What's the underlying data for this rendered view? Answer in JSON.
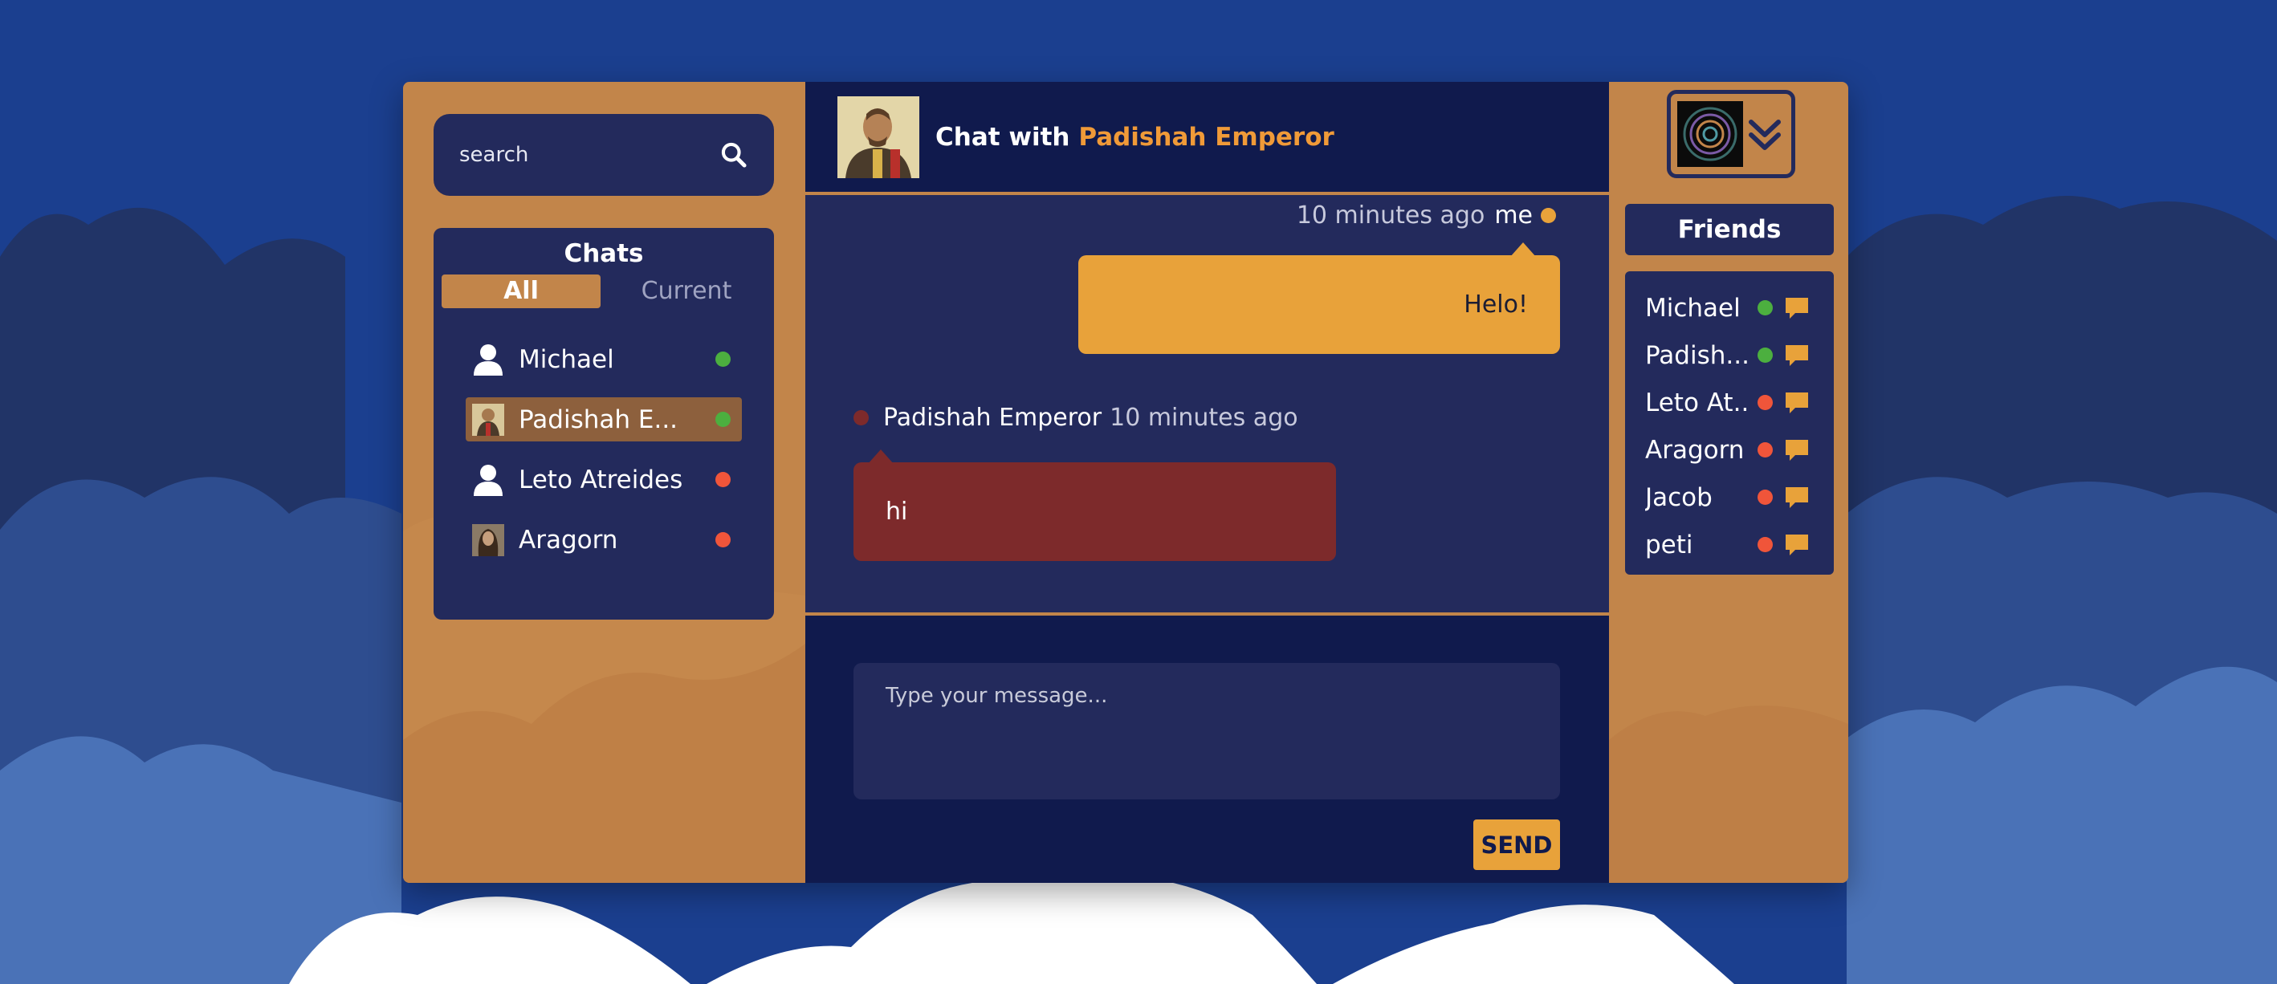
{
  "search": {
    "placeholder": "search"
  },
  "chats": {
    "title": "Chats",
    "tabs": [
      "All",
      "Current"
    ],
    "items": [
      {
        "name": "Michael",
        "avatar": "user-icon",
        "status": "online"
      },
      {
        "name": "Padishah E...",
        "avatar": "portrait-avatar",
        "status": "online",
        "selected": true
      },
      {
        "name": "Leto Atreides",
        "avatar": "user-icon",
        "status": "offline"
      },
      {
        "name": "Aragorn",
        "avatar": "portrait-avatar",
        "status": "offline"
      }
    ]
  },
  "header": {
    "prefix": "Chat with",
    "partner": "Padishah Emperor"
  },
  "messages": [
    {
      "from": "me",
      "time": "10 minutes ago",
      "text": "Helo!"
    },
    {
      "from": "Padishah Emperor",
      "time": "10 minutes ago",
      "text": "hi"
    }
  ],
  "composer": {
    "placeholder": "Type your message...",
    "send_label": "SEND"
  },
  "friends": {
    "title": "Friends",
    "items": [
      {
        "name": "Michael",
        "status": "online"
      },
      {
        "name": "Padish...",
        "status": "online"
      },
      {
        "name": "Leto At...",
        "status": "offline"
      },
      {
        "name": "Aragorn",
        "status": "offline"
      },
      {
        "name": "Jacob",
        "status": "offline"
      },
      {
        "name": "peti",
        "status": "offline"
      }
    ]
  },
  "colors": {
    "background": "#1b3f8f",
    "accent_orange": "#e8a23a",
    "panel_tan": "#c2854a",
    "navy": "#101a4d",
    "panel_navy": "#232a5c",
    "partner_name": "#f09a38",
    "online": "#4caf3f",
    "offline": "#f0553a",
    "their_bubble": "#7d2a2b"
  }
}
